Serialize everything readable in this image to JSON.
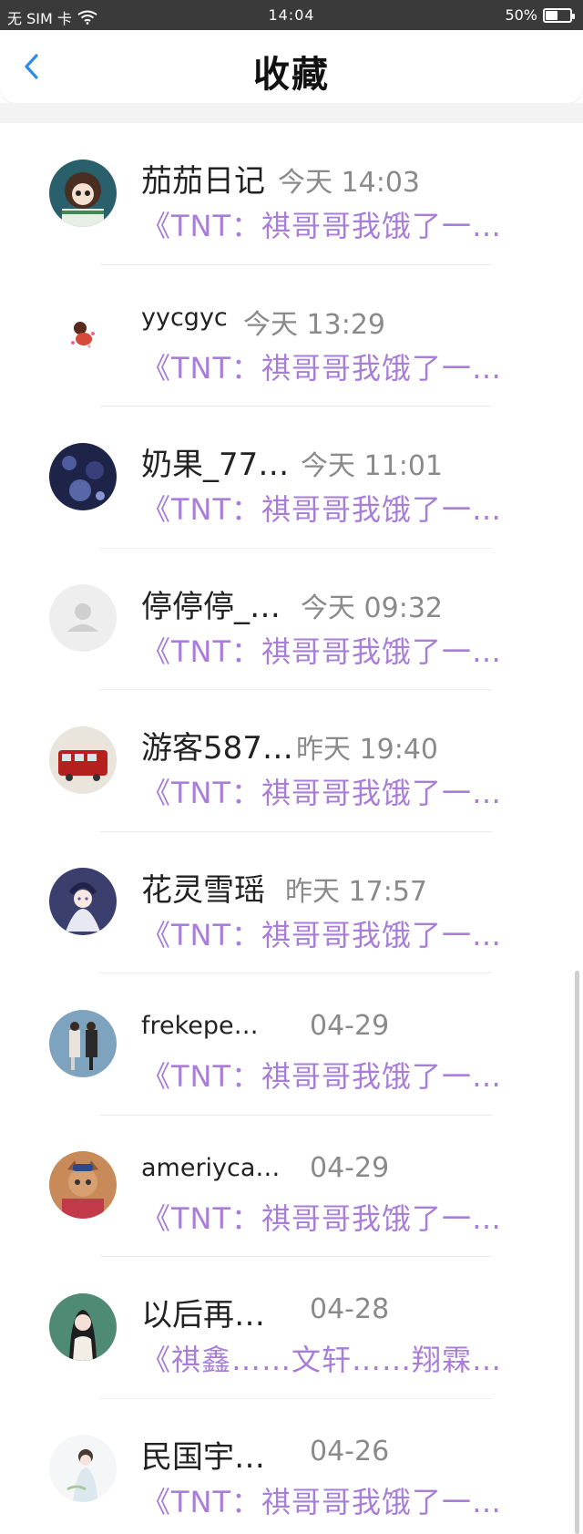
{
  "status": {
    "carrier": "无 SIM 卡",
    "time": "14:04",
    "battery_text": "50%",
    "battery_level": 0.5
  },
  "nav": {
    "title": "收藏"
  },
  "items": [
    {
      "name": "茄茄日记",
      "time": "今天 14:03",
      "preview": "《TNT：祺哥哥我饿了一…"
    },
    {
      "name": "yycgyc",
      "time": "今天 13:29",
      "preview": "《TNT：祺哥哥我饿了一…"
    },
    {
      "name": "奶果_77…",
      "time": "今天 11:01",
      "preview": "《TNT：祺哥哥我饿了一…"
    },
    {
      "name": "停停停_…",
      "time": "今天 09:32",
      "preview": "《TNT：祺哥哥我饿了一…"
    },
    {
      "name": "游客587…",
      "time": "昨天 19:40",
      "preview": "《TNT：祺哥哥我饿了一…"
    },
    {
      "name": "花灵雪瑶",
      "time": "昨天 17:57",
      "preview": "《TNT：祺哥哥我饿了一…"
    },
    {
      "name": "frekepe…",
      "time": "04-29",
      "preview": "《TNT：祺哥哥我饿了一…"
    },
    {
      "name": "ameriyca…",
      "time": "04-29",
      "preview": "《TNT：祺哥哥我饿了一…"
    },
    {
      "name": "以后再…",
      "time": "04-28",
      "preview": "《祺鑫……文轩……翔霖…"
    },
    {
      "name": "民国宇…",
      "time": "04-26",
      "preview": "《TNT：祺哥哥我饿了一…"
    }
  ],
  "colors": {
    "accent": "#2e8be6",
    "preview": "#a87ed8",
    "time": "#8a8a8a",
    "statusbar": "#3a3a3a"
  }
}
